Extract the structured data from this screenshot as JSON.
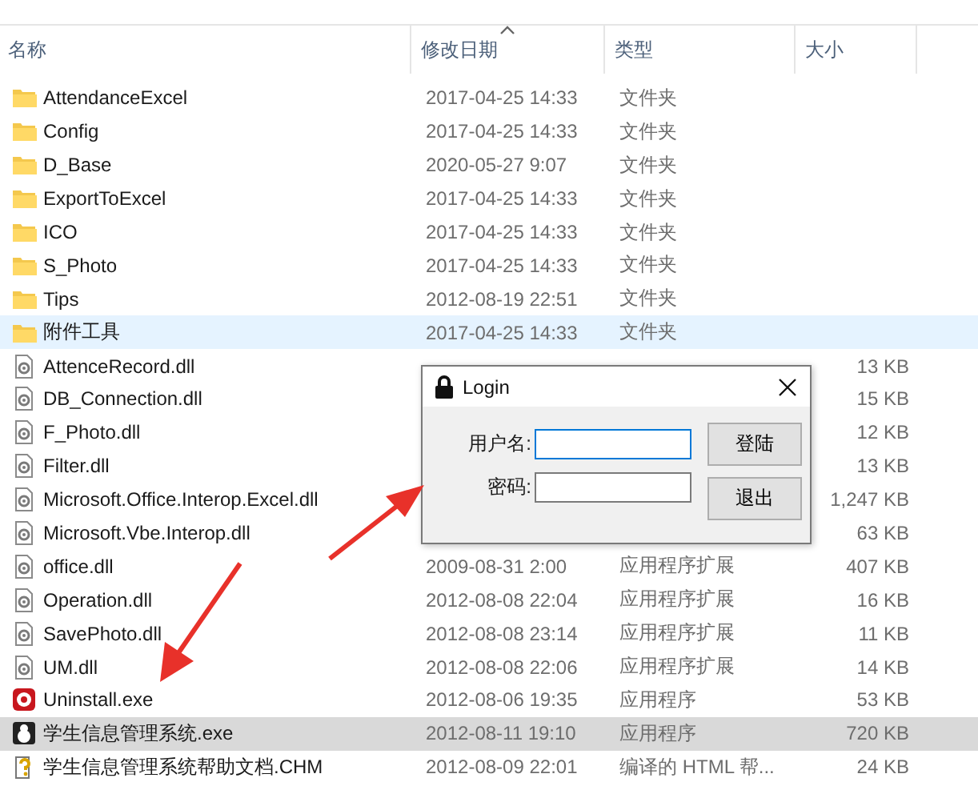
{
  "columns": [
    {
      "label": "名称",
      "sorted": false
    },
    {
      "label": "修改日期",
      "sorted": true
    },
    {
      "label": "类型",
      "sorted": false
    },
    {
      "label": "大小",
      "sorted": false
    }
  ],
  "files": [
    {
      "name": "AttendanceExcel",
      "kind": "folder",
      "date": "2017-04-25 14:33",
      "type": "文件夹",
      "selected": false,
      "hot": false
    },
    {
      "name": "Config",
      "kind": "folder",
      "date": "2017-04-25 14:33",
      "type": "文件夹",
      "selected": false,
      "hot": false
    },
    {
      "name": "D_Base",
      "kind": "folder",
      "date": "2020-05-27 9:07",
      "type": "文件夹",
      "selected": false,
      "hot": false
    },
    {
      "name": "ExportToExcel",
      "kind": "folder",
      "date": "2017-04-25 14:33",
      "type": "文件夹",
      "selected": false,
      "hot": false
    },
    {
      "name": "ICO",
      "kind": "folder",
      "date": "2017-04-25 14:33",
      "type": "文件夹",
      "selected": false,
      "hot": false
    },
    {
      "name": "S_Photo",
      "kind": "folder",
      "date": "2017-04-25 14:33",
      "type": "文件夹",
      "selected": false,
      "hot": false
    },
    {
      "name": "Tips",
      "kind": "folder",
      "date": "2012-08-19 22:51",
      "type": "文件夹",
      "selected": false,
      "hot": false
    },
    {
      "name": "附件工具",
      "kind": "folder",
      "date": "2017-04-25 14:33",
      "type": "文件夹",
      "selected": false,
      "hot": true
    },
    {
      "name": "AttenceRecord.dll",
      "kind": "dll",
      "size": "13 KB",
      "selected": false,
      "hot": false
    },
    {
      "name": "DB_Connection.dll",
      "kind": "dll",
      "size": "15 KB",
      "selected": false,
      "hot": false
    },
    {
      "name": "F_Photo.dll",
      "kind": "dll",
      "size": "12 KB",
      "selected": false,
      "hot": false
    },
    {
      "name": "Filter.dll",
      "kind": "dll",
      "size": "13 KB",
      "selected": false,
      "hot": false
    },
    {
      "name": "Microsoft.Office.Interop.Excel.dll",
      "kind": "dll",
      "size": "1,247 KB",
      "selected": false,
      "hot": false
    },
    {
      "name": "Microsoft.Vbe.Interop.dll",
      "kind": "dll",
      "size": "63 KB",
      "selected": false,
      "hot": false
    },
    {
      "name": "office.dll",
      "kind": "dll",
      "date": "2009-08-31 2:00",
      "type": "应用程序扩展",
      "size": "407 KB",
      "selected": false,
      "hot": false
    },
    {
      "name": "Operation.dll",
      "kind": "dll",
      "date": "2012-08-08 22:04",
      "type": "应用程序扩展",
      "size": "16 KB",
      "selected": false,
      "hot": false
    },
    {
      "name": "SavePhoto.dll",
      "kind": "dll",
      "date": "2012-08-08 23:14",
      "type": "应用程序扩展",
      "size": "11 KB",
      "selected": false,
      "hot": false
    },
    {
      "name": "UM.dll",
      "kind": "dll",
      "date": "2012-08-08 22:06",
      "type": "应用程序扩展",
      "size": "14 KB",
      "selected": false,
      "hot": false
    },
    {
      "name": "Uninstall.exe",
      "kind": "uninstaller",
      "date": "2012-08-06 19:35",
      "type": "应用程序",
      "size": "53 KB",
      "selected": false,
      "hot": false
    },
    {
      "name": "学生信息管理系统.exe",
      "kind": "app",
      "date": "2012-08-11 19:10",
      "type": "应用程序",
      "size": "720 KB",
      "selected": true,
      "hot": false
    },
    {
      "name": "学生信息管理系统帮助文档.CHM",
      "kind": "help",
      "date": "2012-08-09 22:01",
      "type": "编译的 HTML 帮...",
      "size": "24 KB",
      "selected": false,
      "hot": false
    }
  ],
  "dialog": {
    "title": "Login",
    "fields": [
      {
        "label": "用户名:",
        "focused": true
      },
      {
        "label": "密码:",
        "focused": false
      }
    ],
    "buttons": [
      "登陆",
      "退出"
    ]
  }
}
